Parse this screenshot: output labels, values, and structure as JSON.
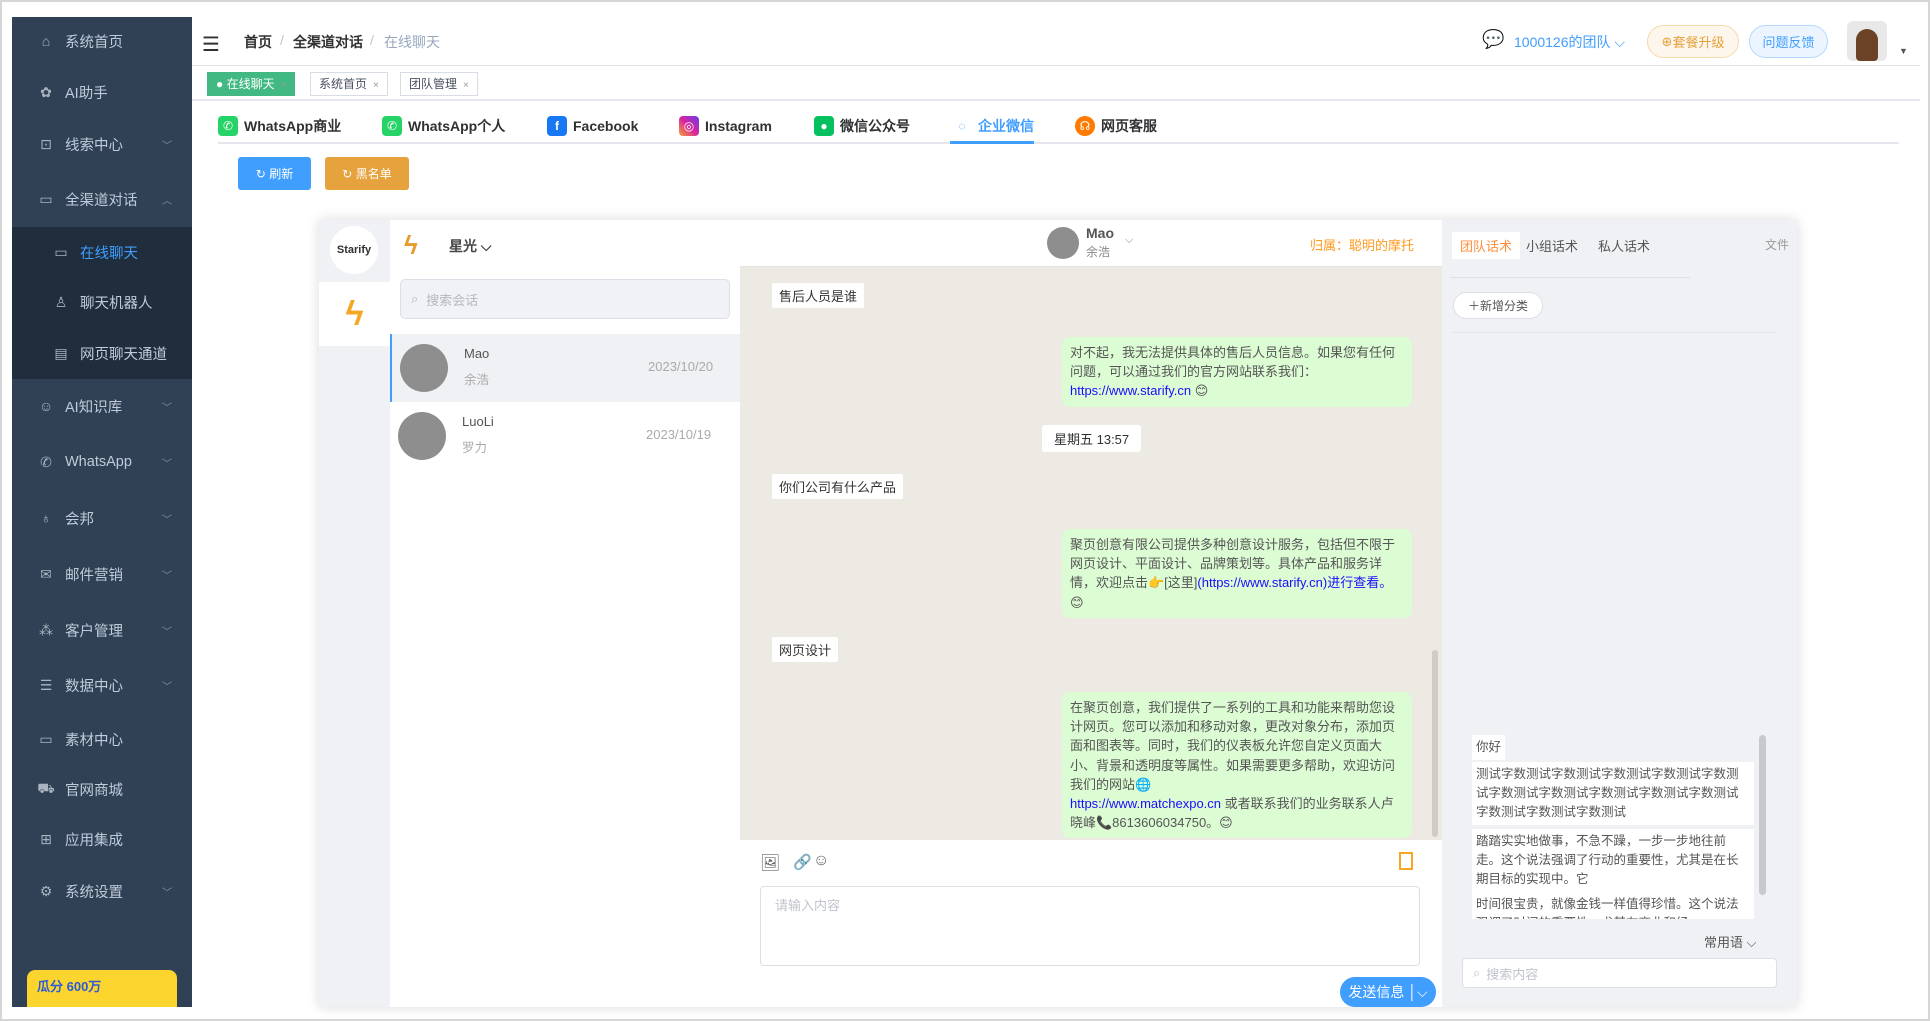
{
  "sidebar": {
    "items": [
      {
        "label": "系统首页",
        "icon": "home-icon"
      },
      {
        "label": "AI助手",
        "icon": "ai-icon"
      },
      {
        "label": "线索中心",
        "icon": "search-doc-icon"
      },
      {
        "label": "全渠道对话",
        "icon": "chat-icon"
      },
      {
        "label": "在线聊天",
        "icon": "chat-icon"
      },
      {
        "label": "聊天机器人",
        "icon": "robot-icon"
      },
      {
        "label": "网页聊天通道",
        "icon": "document-icon"
      },
      {
        "label": "AI知识库",
        "icon": "brain-icon"
      },
      {
        "label": "WhatsApp",
        "icon": "whatsapp-icon"
      },
      {
        "label": "会邦",
        "icon": "bulb-icon"
      },
      {
        "label": "邮件营销",
        "icon": "mail-icon"
      },
      {
        "label": "客户管理",
        "icon": "users-icon"
      },
      {
        "label": "数据中心",
        "icon": "database-icon"
      },
      {
        "label": "素材中心",
        "icon": "folder-icon"
      },
      {
        "label": "官网商城",
        "icon": "cart-icon"
      },
      {
        "label": "应用集成",
        "icon": "apps-icon"
      },
      {
        "label": "系统设置",
        "icon": "gear-icon"
      }
    ],
    "banner": "瓜分 600万"
  },
  "header": {
    "breadcrumb": [
      "首页",
      "全渠道对话",
      "在线聊天"
    ],
    "team": "1000126的团队",
    "upgrade": "套餐升级",
    "feedback": "问题反馈"
  },
  "tags": [
    "在线聊天",
    "系统首页",
    "团队管理"
  ],
  "channels": [
    {
      "label": "WhatsApp商业",
      "color": "#25d366"
    },
    {
      "label": "WhatsApp个人",
      "color": "#25d366"
    },
    {
      "label": "Facebook",
      "color": "#1877f2"
    },
    {
      "label": "Instagram",
      "color": "#d6249f"
    },
    {
      "label": "微信公众号",
      "color": "#07c160"
    },
    {
      "label": "企业微信",
      "color": "#409eff"
    },
    {
      "label": "网页客服",
      "color": "#ff7a00"
    }
  ],
  "actions": {
    "refresh": "刷新",
    "blacklist": "黑名单"
  },
  "chat": {
    "brand": "Starify",
    "account": "星光",
    "search_placeholder": "搜索会话",
    "conversations": [
      {
        "name": "Mao",
        "sub": "余浩",
        "date": "2023/10/20"
      },
      {
        "name": "LuoLi",
        "sub": "罗力",
        "date": "2023/10/19"
      }
    ],
    "contact": {
      "name": "Mao",
      "sub": "余浩",
      "owner": "归属：聪明的摩托"
    },
    "messages": {
      "q1": "售后人员是谁",
      "a1": "对不起，我无法提供具体的售后人员信息。如果您有任何问题，可以通过我们的官方网站联系我们：",
      "a1_link": "https://www.starify.cn",
      "a1_emoji": "😊",
      "time": "星期五 13:57",
      "q2": "你们公司有什么产品",
      "a2": "聚页创意有限公司提供多种创意设计服务，包括但不限于网页设计、平面设计、品牌策划等。具体产品和服务详情，欢迎点击👉[这里]",
      "a2_link": "(https://www.starify.cn)进行查看。",
      "a2_emoji": "😊",
      "q3": "网页设计",
      "a3": "在聚页创意，我们提供了一系列的工具和功能来帮助您设计网页。您可以添加和移动对象，更改对象分布，添加页面和图表等。同时，我们的仪表板允许您自定义页面大小、背景和透明度等属性。如果需要更多帮助，欢迎访问我们的网站🌐",
      "a3_link": "https://www.matchexpo.cn",
      "a3_tail": " 或者联系我们的业务联系人卢晓峰📞8613606034750。😊"
    },
    "input_placeholder": "请输入内容",
    "send": "发送信息"
  },
  "right": {
    "tabs": [
      "团队话术",
      "小组话术",
      "私人话术"
    ],
    "file": "文件",
    "add_category": "新增分类",
    "phrases": [
      "你好",
      "测试字数测试字数测试字数测试字数测试字数测试字数测试字数测试字数测试字数测试字数测试字数测试字数测试字数测试",
      "踏踏实实地做事，不急不躁，一步一步地往前走。这个说法强调了行动的重要性，尤其是在长期目标的实现中。它",
      "时间很宝贵，就像金钱一样值得珍惜。这个说法强调了时间的重要性，尤其在商业和经"
    ],
    "common": "常用语",
    "search_placeholder": "搜索内容"
  }
}
